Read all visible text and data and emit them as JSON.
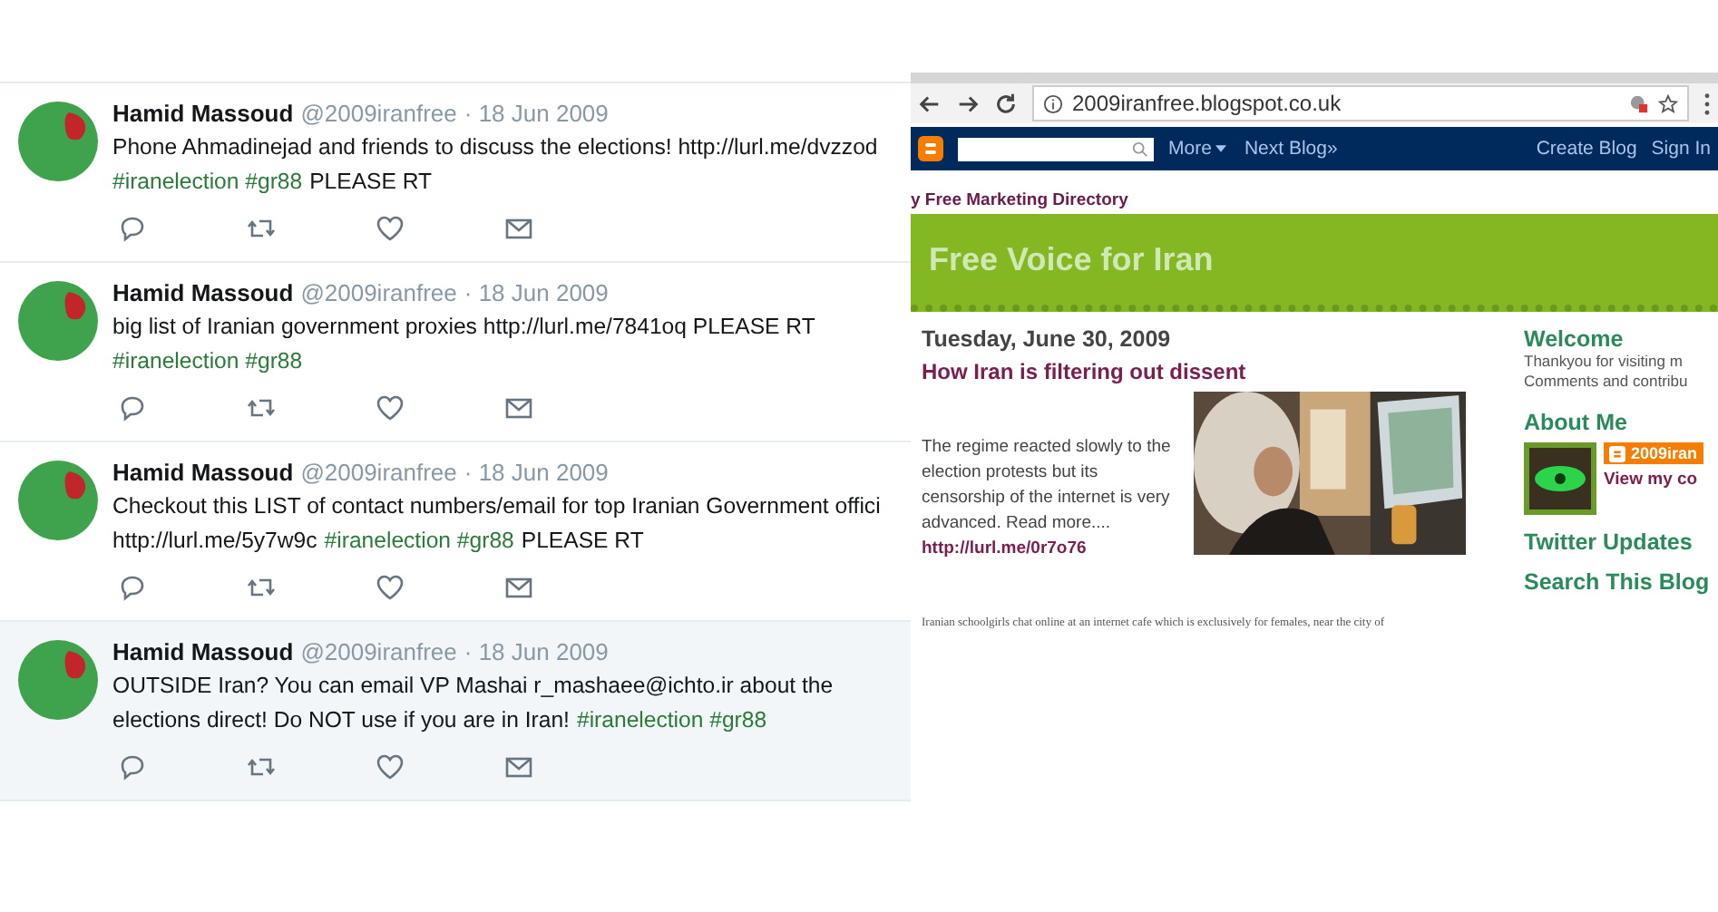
{
  "tweets": [
    {
      "name": "Hamid Massoud",
      "handle": "@2009iranfree",
      "date": "· 18 Jun 2009",
      "highlighted": false,
      "lines": [
        [
          {
            "kind": "plain",
            "text": "Phone Ahmadinejad and friends to discuss the elections! http://lurl.me/dvzzod"
          }
        ],
        [
          {
            "kind": "tag",
            "text": "#iranelection #gr88"
          },
          {
            "kind": "plain",
            "text": "PLEASE RT"
          }
        ]
      ]
    },
    {
      "name": "Hamid Massoud",
      "handle": "@2009iranfree",
      "date": "· 18 Jun 2009",
      "highlighted": false,
      "lines": [
        [
          {
            "kind": "plain",
            "text": "big list of Iranian government proxies http://lurl.me/7841oq PLEASE RT"
          }
        ],
        [
          {
            "kind": "tag",
            "text": "#iranelection #gr88"
          }
        ]
      ]
    },
    {
      "name": "Hamid Massoud",
      "handle": "@2009iranfree",
      "date": "· 18 Jun 2009",
      "highlighted": false,
      "lines": [
        [
          {
            "kind": "plain",
            "text": "Checkout this LIST of contact numbers/email for top Iranian Government offici"
          }
        ],
        [
          {
            "kind": "plain",
            "text": "http://lurl.me/5y7w9c"
          },
          {
            "kind": "tag",
            "text": "#iranelection #gr88"
          },
          {
            "kind": "plain",
            "text": "PLEASE RT"
          }
        ]
      ]
    },
    {
      "name": "Hamid Massoud",
      "handle": "@2009iranfree",
      "date": "· 18 Jun 2009",
      "highlighted": true,
      "lines": [
        [
          {
            "kind": "plain",
            "text": "OUTSIDE Iran? You can email VP Mashai r_mashaee@ichto.ir about the"
          }
        ],
        [
          {
            "kind": "plain",
            "text": "elections direct! Do NOT use if you are in Iran!"
          },
          {
            "kind": "tag",
            "text": "#iranelection #gr88"
          }
        ]
      ]
    }
  ],
  "browser": {
    "address": "2009iranfree.blogspot.co.uk",
    "navbar": {
      "more": "More",
      "next": "Next Blog»",
      "create": "Create Blog",
      "sign_in": "Sign In"
    },
    "directory": "y Free Marketing Directory",
    "blog_title": "Free Voice for Iran",
    "post": {
      "date": "Tuesday, June 30, 2009",
      "title": "How Iran is filtering out dissent",
      "body": "The regime reacted slowly to the election protests but its censorship of the internet is very advanced. Read more....",
      "link": "http://lurl.me/0r7o76",
      "caption": "Iranian schoolgirls chat online at an internet cafe which is exclusively for females, near the city of"
    },
    "sidebar": {
      "welcome": "Welcome",
      "welcome_lines": [
        "Thankyou for visiting m",
        "Comments and contribu"
      ],
      "about": "About Me",
      "profile_name": "2009iran",
      "profile_link": "View my co",
      "twitter": "Twitter Updates",
      "search": "Search This Blog"
    }
  }
}
